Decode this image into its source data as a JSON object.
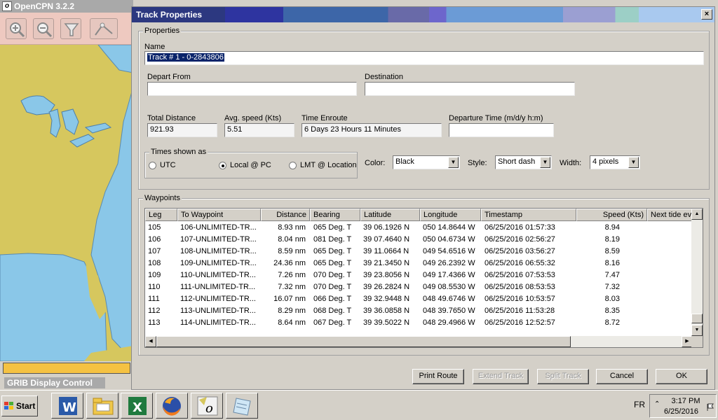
{
  "app": {
    "title": "OpenCPN 3.2.2",
    "grib_title": "GRIB Display Control"
  },
  "icons": {
    "toolbar": [
      "zoom-in-icon",
      "zoom-out-icon",
      "filter-icon",
      "route-icon"
    ]
  },
  "dialog": {
    "title": "Track Properties",
    "close_glyph": "×",
    "properties_label": "Properties",
    "name_label": "Name",
    "name_value": "Track # 1 - 0-2843806",
    "depart_label": "Depart From",
    "depart_value": "",
    "destination_label": "Destination",
    "destination_value": "",
    "total_distance_label": "Total Distance",
    "total_distance_value": "921.93",
    "avg_speed_label": "Avg. speed (Kts)",
    "avg_speed_value": "5.51",
    "time_enroute_label": "Time Enroute",
    "time_enroute_value": "6 Days  23 Hours  11 Minutes",
    "departure_time_label": "Departure Time (m/d/y h:m)",
    "departure_time_value": "",
    "times_group_label": "Times shown as",
    "radio_utc": "UTC",
    "radio_local": "Local @ PC",
    "radio_lmt": "LMT @ Location",
    "color_label": "Color:",
    "color_value": "Black",
    "style_label": "Style:",
    "style_value": "Short dash",
    "width_label": "Width:",
    "width_value": "4 pixels",
    "waypoints_label": "Waypoints",
    "columns": [
      "Leg",
      "To Waypoint",
      "Distance",
      "Bearing",
      "Latitude",
      "Longitude",
      "Timestamp",
      "Speed (Kts)",
      "Next tide ev"
    ],
    "rows": [
      [
        "105",
        "106-UNLIMITED-TR...",
        "8.93 nm",
        "065 Deg. T",
        "39 06.1926 N",
        "050 14.8644 W",
        "06/25/2016 01:57:33",
        "8.94"
      ],
      [
        "106",
        "107-UNLIMITED-TR...",
        "8.04 nm",
        "081 Deg. T",
        "39 07.4640 N",
        "050 04.6734 W",
        "06/25/2016 02:56:27",
        "8.19"
      ],
      [
        "107",
        "108-UNLIMITED-TR...",
        "8.59 nm",
        "065 Deg. T",
        "39 11.0664 N",
        "049 54.6516 W",
        "06/25/2016 03:56:27",
        "8.59"
      ],
      [
        "108",
        "109-UNLIMITED-TR...",
        "24.36 nm",
        "065 Deg. T",
        "39 21.3450 N",
        "049 26.2392 W",
        "06/25/2016 06:55:32",
        "8.16"
      ],
      [
        "109",
        "110-UNLIMITED-TR...",
        "7.26 nm",
        "070 Deg. T",
        "39 23.8056 N",
        "049 17.4366 W",
        "06/25/2016 07:53:53",
        "7.47"
      ],
      [
        "110",
        "111-UNLIMITED-TR...",
        "7.32 nm",
        "070 Deg. T",
        "39 26.2824 N",
        "049 08.5530 W",
        "06/25/2016 08:53:53",
        "7.32"
      ],
      [
        "111",
        "112-UNLIMITED-TR...",
        "16.07 nm",
        "066 Deg. T",
        "39 32.9448 N",
        "048 49.6746 W",
        "06/25/2016 10:53:57",
        "8.03"
      ],
      [
        "112",
        "113-UNLIMITED-TR...",
        "8.29 nm",
        "068 Deg. T",
        "39 36.0858 N",
        "048 39.7650 W",
        "06/25/2016 11:53:28",
        "8.35"
      ],
      [
        "113",
        "114-UNLIMITED-TR...",
        "8.64 nm",
        "067 Deg. T",
        "39 39.5022 N",
        "048 29.4966 W",
        "06/25/2016 12:52:57",
        "8.72"
      ]
    ],
    "buttons": {
      "print_route": "Print Route",
      "extend_track": "Extend Track",
      "split_track": "Split Track",
      "cancel": "Cancel",
      "ok": "OK"
    }
  },
  "taskbar": {
    "start_label": "Start",
    "apps": [
      "word-icon",
      "explorer-icon",
      "excel-icon",
      "firefox-icon",
      "opencpn-icon",
      "notepad-icon"
    ],
    "language": "FR",
    "time": "3:17 PM",
    "date": "6/25/2016"
  }
}
